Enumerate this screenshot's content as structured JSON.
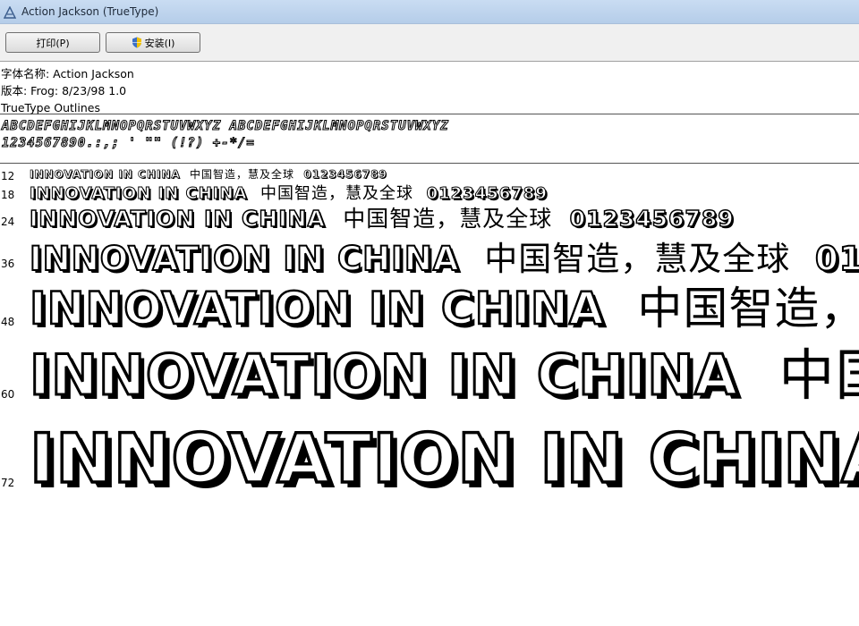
{
  "window": {
    "title": "Action Jackson (TrueType)"
  },
  "toolbar": {
    "print_label": "打印(P)",
    "install_label": "安装(I)"
  },
  "font_info": {
    "name_line": "字体名称: Action Jackson",
    "version_line": "版本: Frog:  8/23/98 1.0",
    "outline_line": "TrueType Outlines"
  },
  "alphabet": {
    "line1": "ABCDEFGHIJKLMNOPQRSTUVWXYZ  ABCDEFGHIJKLMNOPQRSTUVWXYZ",
    "line2": "1234567890.:,;  '  \"\"  (!?)  +-*/="
  },
  "samples": {
    "latin": "INNOVATION IN CHINA",
    "cjk": "中国智造，慧及全球",
    "digits": "0123456789",
    "rows": [
      {
        "size": "12"
      },
      {
        "size": "18"
      },
      {
        "size": "24"
      },
      {
        "size": "36"
      },
      {
        "size": "48"
      },
      {
        "size": "60"
      },
      {
        "size": "72"
      }
    ]
  }
}
